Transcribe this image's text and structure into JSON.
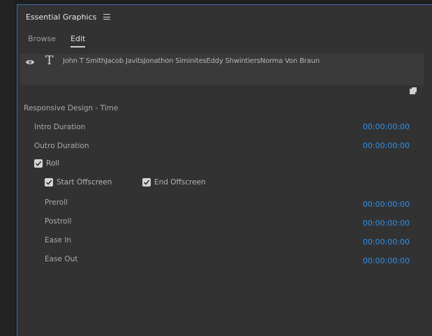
{
  "panel": {
    "title": "Essential Graphics",
    "menu_icon": "hamburger-menu-icon"
  },
  "tabs": [
    {
      "label": "Browse",
      "active": false
    },
    {
      "label": "Edit",
      "active": true
    }
  ],
  "layer": {
    "visibility_icon": "eye-icon",
    "type_icon": "text-tool-icon",
    "text": "John T SmithJacob JavitsJonathon SiminitesEddy ShwintiersNorma Von Braun"
  },
  "section": {
    "title": "Responsive Design - Time"
  },
  "properties": {
    "intro_duration": {
      "label": "Intro Duration",
      "value": "00:00:00:00"
    },
    "outro_duration": {
      "label": "Outro Duration",
      "value": "00:00:00:00"
    },
    "roll": {
      "label": "Roll",
      "checked": true
    },
    "start_offscreen": {
      "label": "Start Offscreen",
      "checked": true
    },
    "end_offscreen": {
      "label": "End Offscreen",
      "checked": true
    },
    "preroll": {
      "label": "Preroll",
      "value": "00:00:00:00"
    },
    "postroll": {
      "label": "Postroll",
      "value": "00:00:00:00"
    },
    "ease_in": {
      "label": "Ease In",
      "value": "00:00:00:00"
    },
    "ease_out": {
      "label": "Ease Out",
      "value": "00:00:00:00"
    }
  },
  "colors": {
    "panel_bg": "#323232",
    "layer_bg": "#3a3a3a",
    "timecode_blue": "#2f8fe8",
    "panel_border": "#3c6fa8"
  }
}
